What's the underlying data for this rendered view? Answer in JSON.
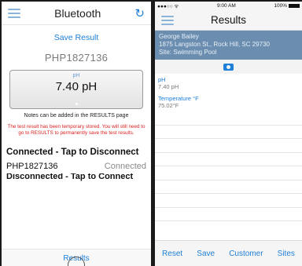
{
  "left": {
    "title": "Bluetooth",
    "refresh_icon": "↻",
    "save_result": "Save Result",
    "device_id": "PHP1827136",
    "reading_label": "pH",
    "reading_value": "7.40 pH",
    "notes": "Notes can be added in the RESULTS page",
    "warning": "The test result has been temporary stored.  You will still need to go to RESULTS to permanently save the test results.",
    "connected_action": "Connected - Tap to Disconnect",
    "device_name": "PHP1827136",
    "device_status": "Connected",
    "disconnected_action": "Disconnected - Tap to Connect",
    "footer": "Results"
  },
  "right": {
    "status": {
      "signal": "●●●○○ ᯤ",
      "time": "9:00 AM",
      "battery": "100%"
    },
    "title": "Results",
    "site": {
      "name": "George Bailey",
      "address": "1875 Langston St., Rock Hill, SC 29730",
      "site": "Site: Swimming Pool"
    },
    "results": [
      {
        "label": "pH",
        "value": "7.40 pH"
      },
      {
        "label": "Temperature °F",
        "value": "75.02°F"
      }
    ],
    "footer": {
      "reset": "Reset",
      "save": "Save",
      "customer": "Customer",
      "sites": "Sites"
    }
  },
  "colors": {
    "accent": "#1e80d8",
    "site_band": "#6b8eb0",
    "warning": "#d82020"
  }
}
